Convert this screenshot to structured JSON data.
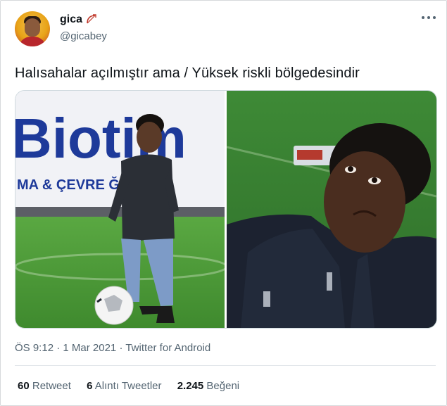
{
  "user": {
    "display_name": "gica",
    "handle": "@gicabey",
    "badge_icon": "bow-arrow-icon",
    "avatar_icon": "avatar-icon"
  },
  "tweet": {
    "text": "Halısahalar açılmıştır ama / Yüksek riskli bölgedesindir"
  },
  "media": {
    "left_banner_line1": "Biotim",
    "left_banner_line2": "MA & ÇEVRE ĞI HİZM"
  },
  "meta": {
    "time": "ÖS 9:12",
    "date": "1 Mar 2021",
    "source": "Twitter for Android",
    "separator": " · "
  },
  "stats": {
    "retweets_count": "60",
    "retweets_label": "Retweet",
    "quotes_count": "6",
    "quotes_label": "Alıntı Tweetler",
    "likes_count": "2.245",
    "likes_label": "Beğeni"
  },
  "colors": {
    "text_primary": "#0f1419",
    "text_secondary": "#536471",
    "border": "#d6d9dc",
    "grass": "#4f9b3a",
    "banner_blue": "#1e3a9a"
  }
}
